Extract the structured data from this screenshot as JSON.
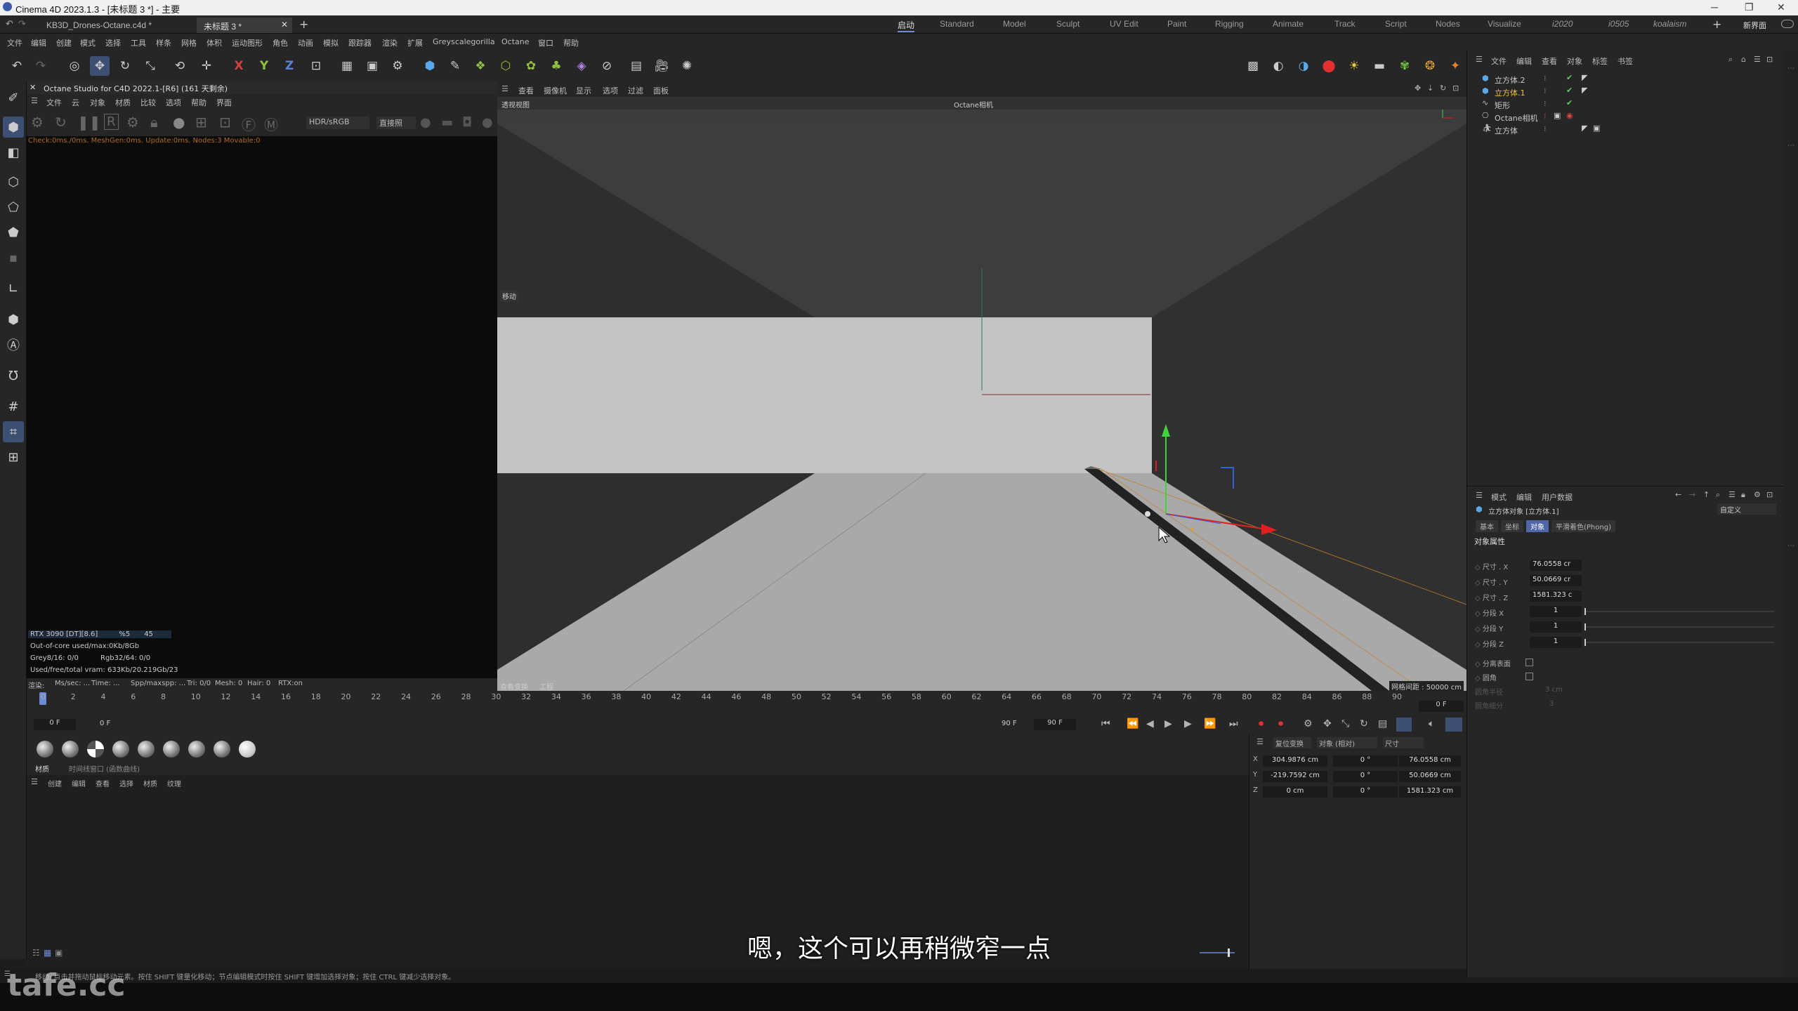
{
  "window": {
    "title": "Cinema 4D 2023.1.3 - [未标题 3 *] - 主要"
  },
  "doc_tabs": [
    {
      "label": "KB3D_Drones-Octane.c4d *"
    },
    {
      "label": "未标题 3 *"
    }
  ],
  "layouts": [
    "启动",
    "Standard",
    "Model",
    "Sculpt",
    "UV Edit",
    "Paint",
    "Rigging",
    "Animate",
    "Track",
    "Script",
    "Nodes",
    "Visualize",
    "i2020",
    "i0505",
    "koalaism"
  ],
  "layout_active": "启动",
  "new_interface": "新界面",
  "menu": [
    "文件",
    "编辑",
    "创建",
    "模式",
    "选择",
    "工具",
    "样条",
    "网格",
    "体积",
    "运动图形",
    "角色",
    "动画",
    "模拟",
    "跟踪器",
    "渲染",
    "扩展",
    "Greyscalegorilla",
    "Octane",
    "窗口",
    "帮助"
  ],
  "axis_buttons": [
    "X",
    "Y",
    "Z"
  ],
  "octane": {
    "header": "Octane Studio for C4D 2022.1-[R6] (161 天剩余)",
    "menu": [
      "文件",
      "云",
      "对象",
      "材质",
      "比较",
      "选项",
      "帮助",
      "界面"
    ],
    "mode": "HDR/sRGB",
    "render_mode": "直接照",
    "status": "Check:0ms./0ms. MeshGen:0ms. Update:0ms. Nodes:3 Movable:0",
    "gpu_stats": {
      "gpu": "RTX 3090 [DT][8.6]",
      "pct": "%5",
      "temp": "45"
    },
    "out_of_core": "Out-of-core used/max:0Kb/8Gb",
    "grey": "Grey8/16: 0/0",
    "rgb": "Rgb32/64: 0/0",
    "vram": "Used/free/total vram: 633Kb/20.219Gb/23",
    "bottom_line": [
      "渲染:",
      "Ms/sec: ...",
      "Time: ...",
      "Spp/maxspp: ...",
      "Tri: 0/0",
      "Mesh: 0",
      "Hair: 0",
      "RTX:on"
    ]
  },
  "viewport": {
    "menu": [
      "查看",
      "摄像机",
      "显示",
      "选项",
      "过滤",
      "面板"
    ],
    "label": "透视视图",
    "camera": "Octane相机",
    "move_label": "移动",
    "footer_left": [
      "查看变换",
      "工程"
    ],
    "grid_spacing": "网格间距 : 50000 cm"
  },
  "objects": {
    "menu": [
      "文件",
      "编辑",
      "查看",
      "对象",
      "标签",
      "书签"
    ],
    "items": [
      {
        "name": "立方体.2",
        "selected": false
      },
      {
        "name": "立方体.1",
        "selected": true
      },
      {
        "name": "矩形",
        "selected": false
      },
      {
        "name": "Octane相机",
        "selected": false
      },
      {
        "name": "立方体",
        "selected": false
      }
    ]
  },
  "attributes": {
    "menu": [
      "模式",
      "编辑",
      "用户数据"
    ],
    "object_title": "立方体对象 [立方体.1]",
    "preset": "自定义",
    "tabs": [
      "基本",
      "坐标",
      "对象",
      "平滑着色(Phong)"
    ],
    "active_tab": "对象",
    "section": "对象属性",
    "props": [
      {
        "label": "尺寸 . X",
        "value": "76.0558 cr"
      },
      {
        "label": "尺寸 . Y",
        "value": "50.0669 cr"
      },
      {
        "label": "尺寸 . Z",
        "value": "1581.323 c"
      },
      {
        "label": "分段 X",
        "value": "1"
      },
      {
        "label": "分段 Y",
        "value": "1"
      },
      {
        "label": "分段 Z",
        "value": "1"
      }
    ],
    "checks": [
      {
        "label": "分离表面"
      },
      {
        "label": "圆角"
      }
    ],
    "disabled": [
      {
        "label": "圆角半径",
        "value": "3 cm"
      },
      {
        "label": "圆角细分",
        "value": "3"
      }
    ]
  },
  "timeline": {
    "ticks": [
      "0",
      "2",
      "4",
      "6",
      "8",
      "10",
      "12",
      "14",
      "16",
      "18",
      "20",
      "22",
      "24",
      "26",
      "28",
      "30",
      "32",
      "34",
      "36",
      "38",
      "40",
      "42",
      "44",
      "46",
      "48",
      "50",
      "52",
      "54",
      "56",
      "58",
      "60",
      "62",
      "64",
      "66",
      "68",
      "70",
      "72",
      "74",
      "76",
      "78",
      "80",
      "82",
      "84",
      "86",
      "88",
      "90"
    ],
    "current_frame": "0 F",
    "start": "0 F",
    "start2": "0 F",
    "end": "90 F",
    "end2": "90 F"
  },
  "materials": {
    "tabs": [
      "材质",
      "时间线窗口 (函数曲线)"
    ],
    "menu": [
      "创建",
      "编辑",
      "查看",
      "选择",
      "材质",
      "纹理"
    ]
  },
  "coords": {
    "mode_labels": [
      "复位变换",
      "对象 (相对)",
      "尺寸"
    ],
    "rows": [
      {
        "axis": "X",
        "pos": "304.9876 cm",
        "rot": "0 °",
        "size": "76.0558 cm"
      },
      {
        "axis": "Y",
        "pos": "-219.7592 cm",
        "rot": "0 °",
        "size": "50.0669 cm"
      },
      {
        "axis": "Z",
        "pos": "0 cm",
        "rot": "0 °",
        "size": "1581.323 cm"
      }
    ]
  },
  "statusbar": "移动: 点击并拖动鼠标移动元素。按住 SHIFT 键量化移动；节点编辑模式时按住 SHIFT 键增加选择对象；按住 CTRL 键减少选择对象。",
  "subtitle": "嗯，这个可以再稍微窄一点",
  "watermark": "tafe.cc"
}
